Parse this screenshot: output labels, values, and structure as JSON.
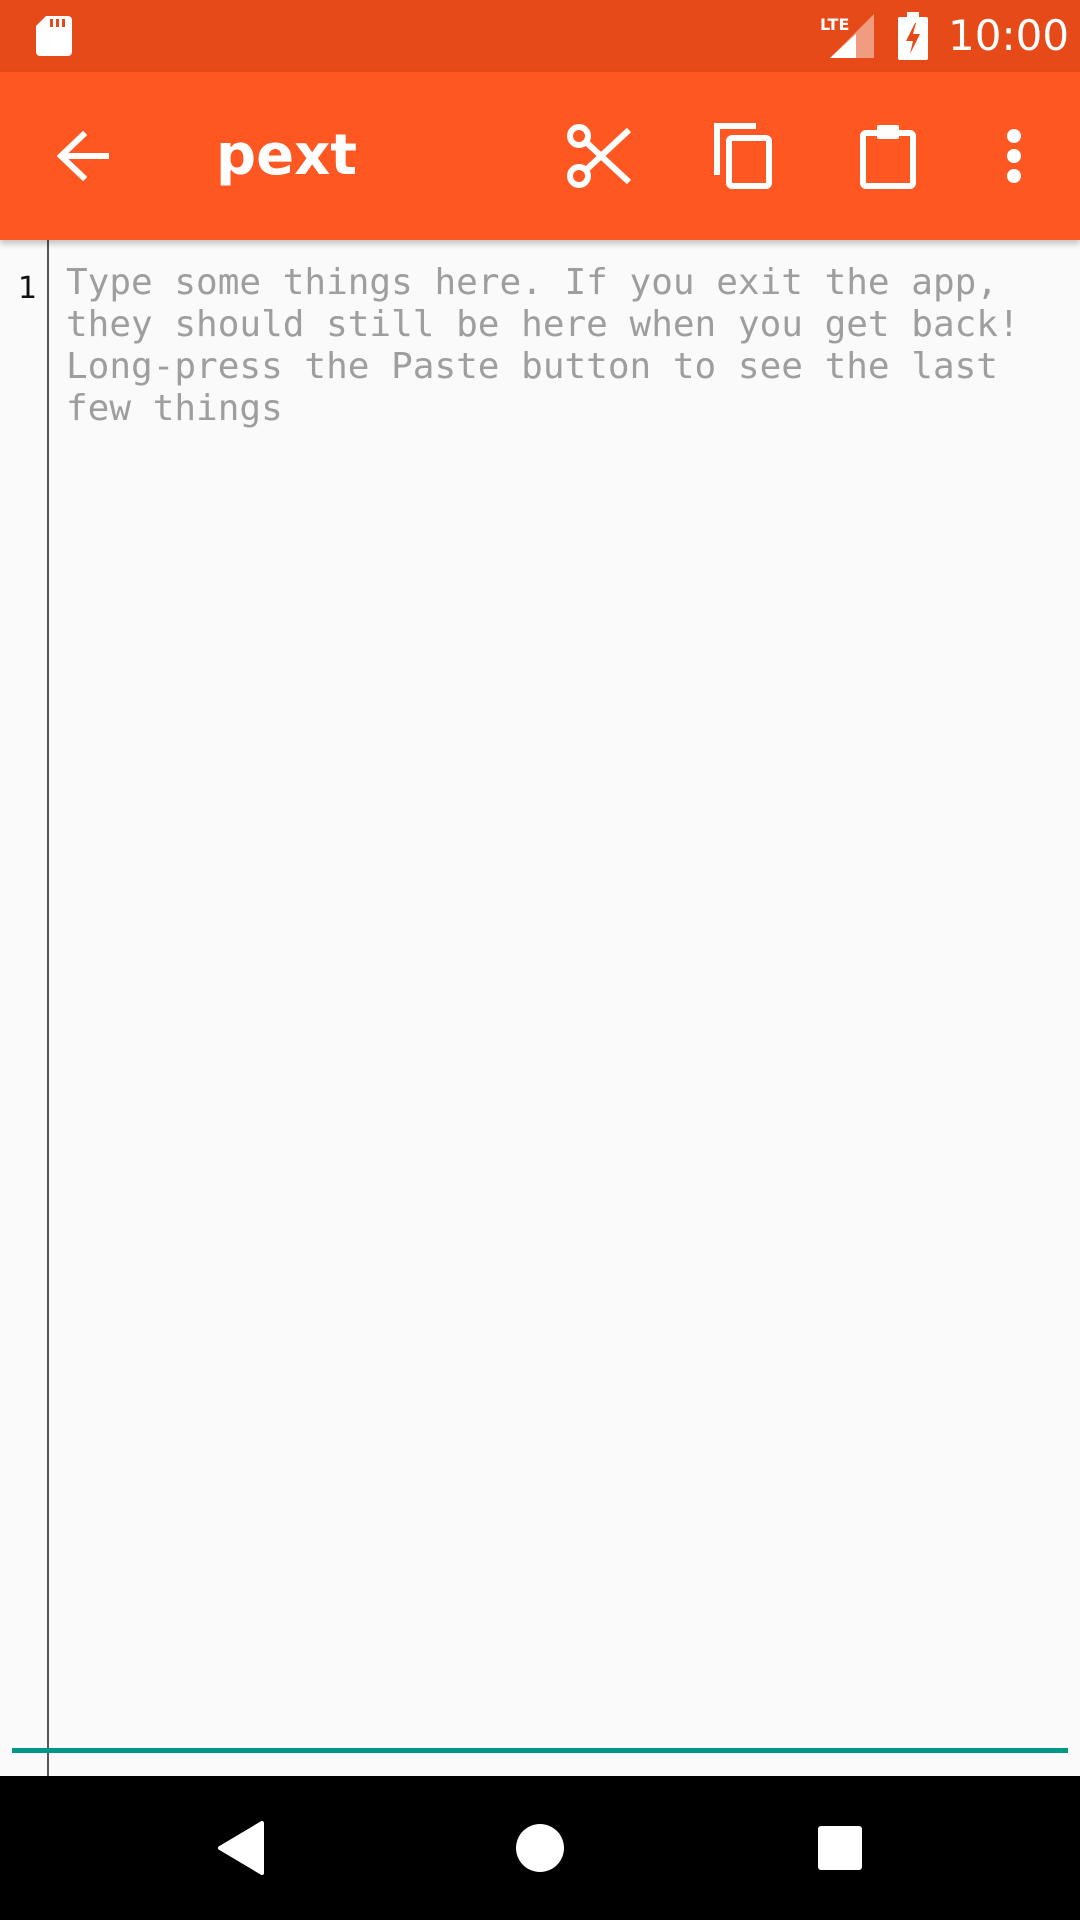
{
  "status_bar": {
    "network": "LTE",
    "time": "10:00",
    "icons": [
      "sd-card-icon",
      "lte-signal-icon",
      "battery-charging-icon"
    ]
  },
  "app_bar": {
    "title": "pext",
    "actions": [
      "back-arrow-icon",
      "cut-icon",
      "copy-icon",
      "paste-icon",
      "more-vert-icon"
    ]
  },
  "editor": {
    "line_numbers": [
      "1"
    ],
    "placeholder": "Type some things here. If you exit the app, they should still be here when you get back! Long-press the Paste button to see the last few things"
  },
  "navigation_bar": {
    "icons": [
      "nav-back-icon",
      "nav-home-icon",
      "nav-recents-icon"
    ]
  },
  "colors": {
    "status_bar": "#e64a19",
    "app_bar": "#ff5722",
    "editor_background": "#fafafa",
    "placeholder_text": "#9e9e9e",
    "focus_underline": "#009688",
    "nav_bar": "#000000"
  }
}
